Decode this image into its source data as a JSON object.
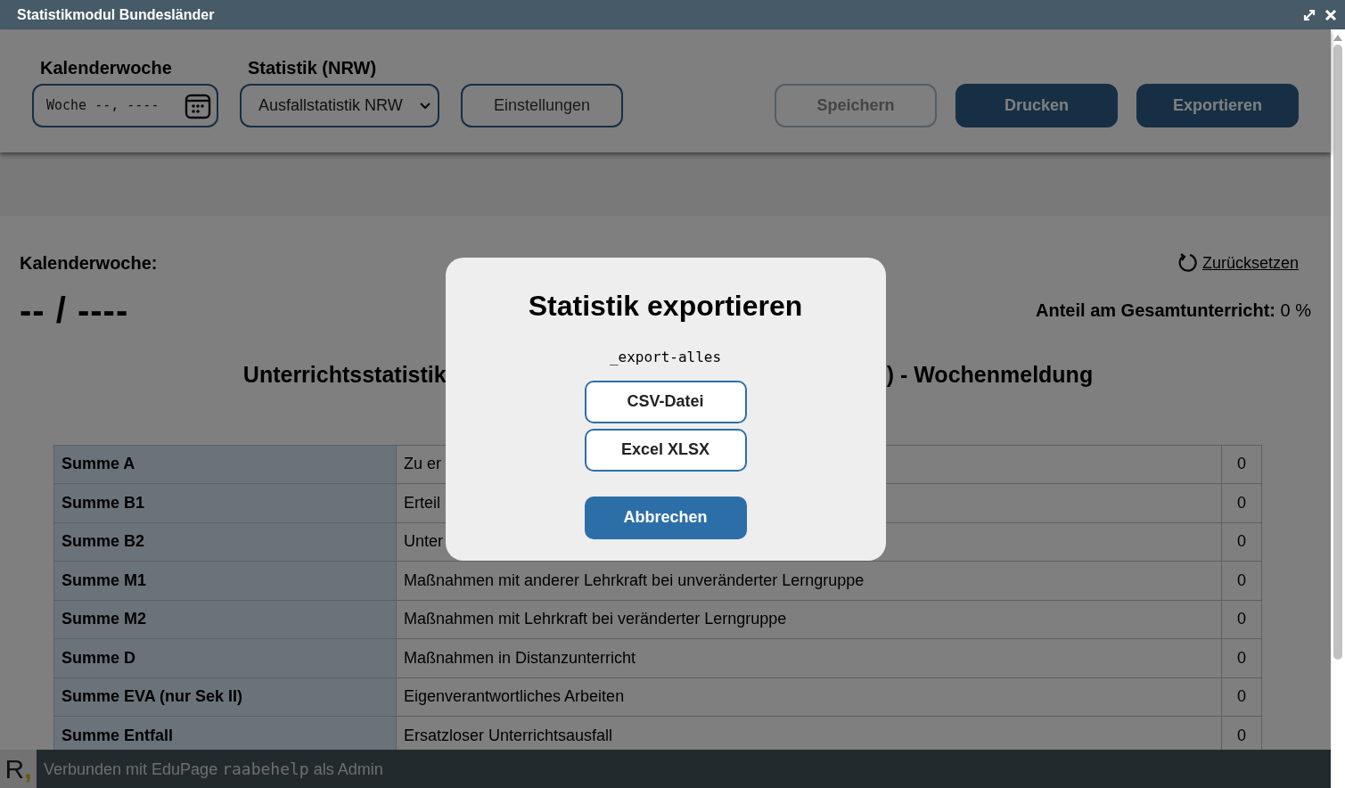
{
  "window": {
    "title": "Statistikmodul Bundesländer"
  },
  "toolbar": {
    "week_label": "Kalenderwoche",
    "week_value": "Woche --, ----",
    "stat_label": "Statistik (NRW)",
    "stat_value": "Ausfallstatistik NRW",
    "buttons": [
      {
        "label": "Einstellungen",
        "kind": "outline",
        "disabled": false
      },
      {
        "label": "Speichern",
        "kind": "outline",
        "disabled": true
      },
      {
        "label": "Drucken",
        "kind": "solid",
        "disabled": false
      },
      {
        "label": "Exportieren",
        "kind": "solid",
        "disabled": false
      }
    ]
  },
  "summary": {
    "week_label": "Kalenderwoche:",
    "week_value": "-- / ----",
    "reset": "Zurücksetzen",
    "share_label": "Anteil am Gesamtunterricht:",
    "share_value": "0 %"
  },
  "heading": {
    "left": "Unterrichtsstatistik",
    "right": ") - Wochenmeldung"
  },
  "table": {
    "rows": [
      {
        "name": "Summe A",
        "description": "Zu er",
        "value": "0"
      },
      {
        "name": "Summe B1",
        "description": "Erteil",
        "value": "0"
      },
      {
        "name": "Summe B2",
        "description": "Unter",
        "value": "0"
      },
      {
        "name": "Summe M1",
        "description": "Maßnahmen mit anderer Lehrkraft bei unveränderter Lerngruppe",
        "value": "0"
      },
      {
        "name": "Summe M2",
        "description": "Maßnahmen mit Lehrkraft bei veränderter Lerngruppe",
        "value": "0"
      },
      {
        "name": "Summe D",
        "description": "Maßnahmen in Distanzunterricht",
        "value": "0"
      },
      {
        "name": "Summe EVA (nur Sek II)",
        "description": "Eigenverantwortliches Arbeiten",
        "value": "0"
      },
      {
        "name": "Summe Entfall",
        "description": "Ersatzloser Unterrichtsausfall",
        "value": "0"
      }
    ]
  },
  "status_bar": {
    "logo_letter": "R",
    "logo_mark": ",",
    "text_before": "Verbunden mit EduPage",
    "user": "raabehelp",
    "text_after": "als Admin"
  },
  "dialog": {
    "title": "Statistik exportieren",
    "filename": "_export-alles",
    "buttons": [
      {
        "label": "CSV-Datei",
        "kind": "outline"
      },
      {
        "label": "Excel XLSX",
        "kind": "outline"
      },
      {
        "label": "Abbrechen",
        "kind": "solid"
      }
    ]
  }
}
